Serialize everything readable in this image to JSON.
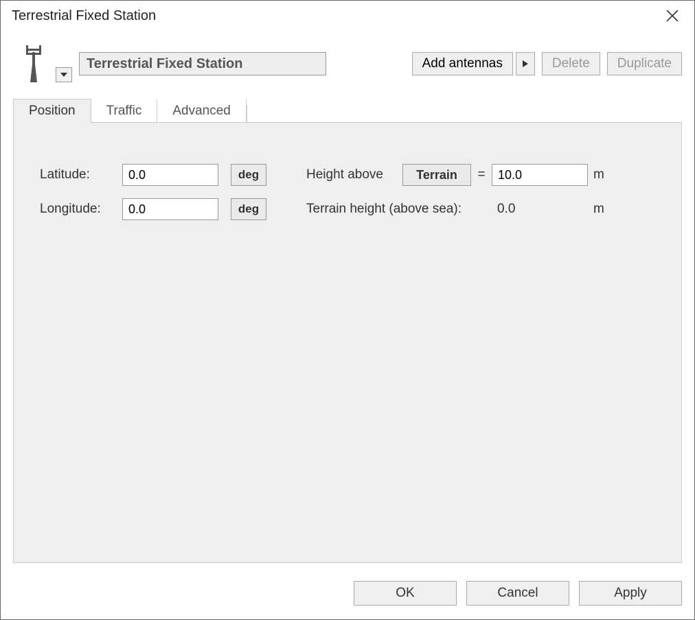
{
  "window": {
    "title": "Terrestrial Fixed Station"
  },
  "header": {
    "station_name": "Terrestrial Fixed Station",
    "add_antennas": "Add antennas",
    "delete": "Delete",
    "duplicate": "Duplicate"
  },
  "tabs": {
    "position": "Position",
    "traffic": "Traffic",
    "advanced": "Advanced"
  },
  "position": {
    "latitude_label": "Latitude:",
    "latitude_value": "0.0",
    "latitude_unit": "deg",
    "longitude_label": "Longitude:",
    "longitude_value": "0.0",
    "longitude_unit": "deg",
    "height_above_label": "Height above",
    "height_above_mode": "Terrain",
    "equals": "=",
    "height_value": "10.0",
    "height_unit": "m",
    "terrain_height_label": "Terrain height (above sea):",
    "terrain_height_value": "0.0",
    "terrain_height_unit": "m"
  },
  "footer": {
    "ok": "OK",
    "cancel": "Cancel",
    "apply": "Apply"
  }
}
